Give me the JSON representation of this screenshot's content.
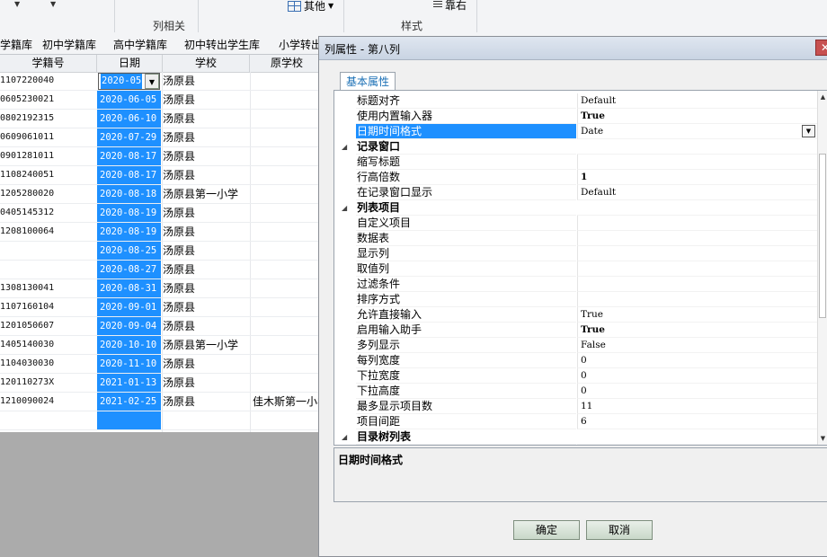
{
  "ribbon": {
    "group_labels": [
      "列相关",
      "样式"
    ],
    "other_label": "其他",
    "right_label": "靠右"
  },
  "module_tabs": [
    "学籍库",
    "初中学籍库",
    "高中学籍库",
    "初中转出学生库",
    "小学转出"
  ],
  "grid": {
    "headers": [
      "学籍号",
      "日期",
      "学校",
      "原学校"
    ],
    "rows": [
      {
        "id": "1107220040",
        "date": "2020-05",
        "school": "汤原县",
        "orig": ""
      },
      {
        "id": "0605230021",
        "date": "2020-06-05",
        "school": "汤原县",
        "orig": ""
      },
      {
        "id": "0802192315",
        "date": "2020-06-10",
        "school": "汤原县",
        "orig": ""
      },
      {
        "id": "0609061011",
        "date": "2020-07-29",
        "school": "汤原县",
        "orig": ""
      },
      {
        "id": "0901281011",
        "date": "2020-08-17",
        "school": "汤原县",
        "orig": ""
      },
      {
        "id": "1108240051",
        "date": "2020-08-17",
        "school": "汤原县",
        "orig": ""
      },
      {
        "id": "1205280020",
        "date": "2020-08-18",
        "school": "汤原县第一小学",
        "orig": ""
      },
      {
        "id": "0405145312",
        "date": "2020-08-19",
        "school": "汤原县",
        "orig": ""
      },
      {
        "id": "1208100064",
        "date": "2020-08-19",
        "school": "汤原县",
        "orig": ""
      },
      {
        "id": "",
        "date": "2020-08-25",
        "school": "汤原县",
        "orig": ""
      },
      {
        "id": "",
        "date": "2020-08-27",
        "school": "汤原县",
        "orig": ""
      },
      {
        "id": "1308130041",
        "date": "2020-08-31",
        "school": "汤原县",
        "orig": ""
      },
      {
        "id": "1107160104",
        "date": "2020-09-01",
        "school": "汤原县",
        "orig": ""
      },
      {
        "id": "1201050607",
        "date": "2020-09-04",
        "school": "汤原县",
        "orig": ""
      },
      {
        "id": "1405140030",
        "date": "2020-10-10",
        "school": "汤原县第一小学",
        "orig": ""
      },
      {
        "id": "1104030030",
        "date": "2020-11-10",
        "school": "汤原县",
        "orig": ""
      },
      {
        "id": "120110273X",
        "date": "2021-01-13",
        "school": "汤原县",
        "orig": ""
      },
      {
        "id": "1210090024",
        "date": "2021-02-25",
        "school": "汤原县",
        "orig": "佳木斯第一小学"
      },
      {
        "id": "",
        "date": "",
        "school": "",
        "orig": ""
      }
    ]
  },
  "dialog": {
    "title": "列属性 - 第八列",
    "close_glyph": "✕",
    "tab_label": "基本属性",
    "properties": [
      {
        "type": "prop",
        "name": "标题对齐",
        "value": "Default",
        "bold": false
      },
      {
        "type": "prop",
        "name": "使用内置输入器",
        "value": "True",
        "bold": true
      },
      {
        "type": "prop",
        "name": "日期时间格式",
        "value": "Date",
        "bold": false,
        "selected": true,
        "dropdown": true
      },
      {
        "type": "cat",
        "name": "记录窗口"
      },
      {
        "type": "prop",
        "name": "缩写标题",
        "value": "",
        "bold": false
      },
      {
        "type": "prop",
        "name": "行高倍数",
        "value": "1",
        "bold": true
      },
      {
        "type": "prop",
        "name": "在记录窗口显示",
        "value": "Default",
        "bold": false
      },
      {
        "type": "cat",
        "name": "列表项目"
      },
      {
        "type": "prop",
        "name": "自定义项目",
        "value": "",
        "bold": false
      },
      {
        "type": "prop",
        "name": "数据表",
        "value": "",
        "bold": false
      },
      {
        "type": "prop",
        "name": "显示列",
        "value": "",
        "bold": false
      },
      {
        "type": "prop",
        "name": "取值列",
        "value": "",
        "bold": false
      },
      {
        "type": "prop",
        "name": "过滤条件",
        "value": "",
        "bold": false
      },
      {
        "type": "prop",
        "name": "排序方式",
        "value": "",
        "bold": false
      },
      {
        "type": "prop",
        "name": "允许直接输入",
        "value": "True",
        "bold": false
      },
      {
        "type": "prop",
        "name": "启用输入助手",
        "value": "True",
        "bold": true
      },
      {
        "type": "prop",
        "name": "多列显示",
        "value": "False",
        "bold": false
      },
      {
        "type": "prop",
        "name": "每列宽度",
        "value": "0",
        "bold": false
      },
      {
        "type": "prop",
        "name": "下拉宽度",
        "value": "0",
        "bold": false
      },
      {
        "type": "prop",
        "name": "下拉高度",
        "value": "0",
        "bold": false
      },
      {
        "type": "prop",
        "name": "最多显示项目数",
        "value": "11",
        "bold": false
      },
      {
        "type": "prop",
        "name": "项目间距",
        "value": "6",
        "bold": false
      },
      {
        "type": "cat",
        "name": "目录树列表"
      }
    ],
    "description_title": "日期时间格式",
    "ok_label": "确定",
    "cancel_label": "取消"
  },
  "colors": {
    "selection_blue": "#1e90ff",
    "desktop_gray": "#ababab"
  }
}
